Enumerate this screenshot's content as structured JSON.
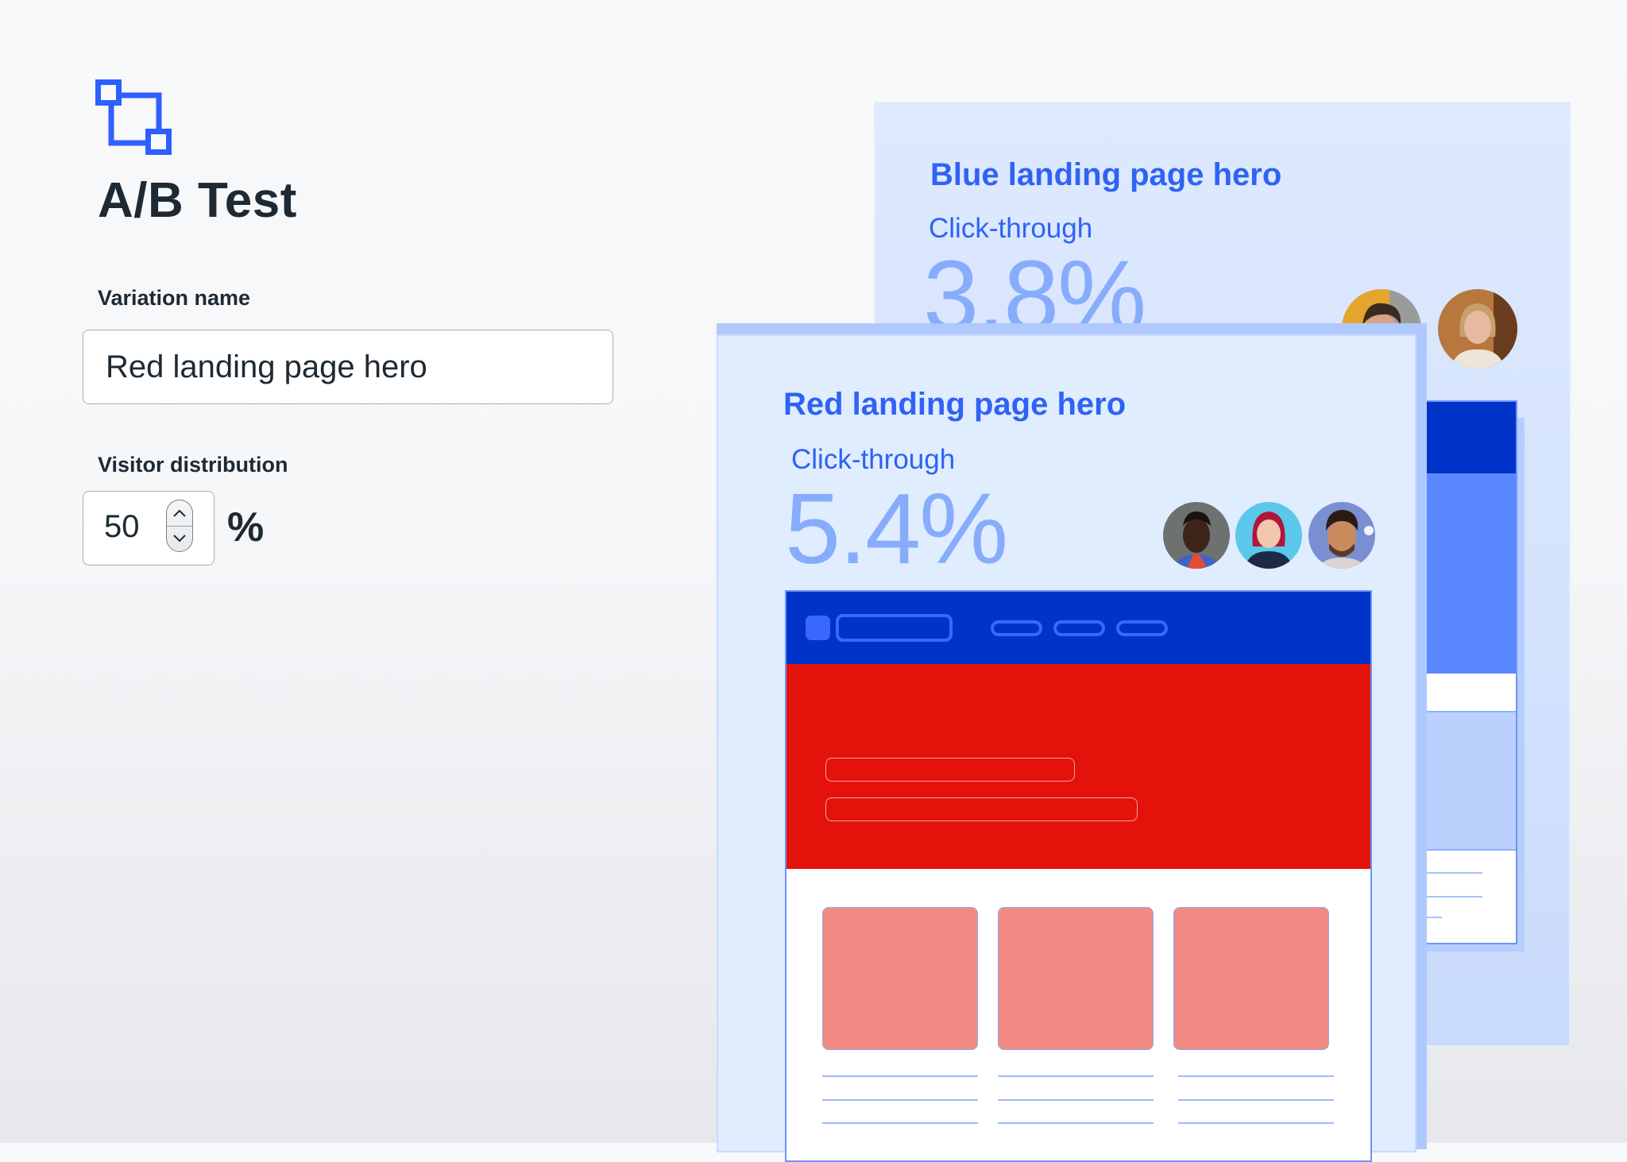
{
  "header": {
    "logo_icon": "ab-test-nodes-icon",
    "title": "A/B Test"
  },
  "form": {
    "variation_name_label": "Variation name",
    "variation_name_value": "Red landing page hero",
    "visitor_distribution_label": "Visitor distribution",
    "visitor_distribution_value": "50",
    "visitor_distribution_unit": "%",
    "stepper_up_icon": "chevron-up-icon",
    "stepper_down_icon": "chevron-down-icon"
  },
  "variations": [
    {
      "title": "Blue landing page hero",
      "metric_label": "Click-through",
      "metric_value": "3.8%",
      "hero_color": "#5a88ff",
      "avatar_count": 2
    },
    {
      "title": "Red landing page hero",
      "metric_label": "Click-through",
      "metric_value": "5.4%",
      "hero_color": "#e3130b",
      "avatar_count": 3
    }
  ],
  "colors": {
    "accent": "#2f62f5",
    "nav_dark_blue": "#0033c7",
    "metric_value": "#88acfc",
    "red_tile": "#f28a84",
    "text_dark": "#1e2a33"
  }
}
